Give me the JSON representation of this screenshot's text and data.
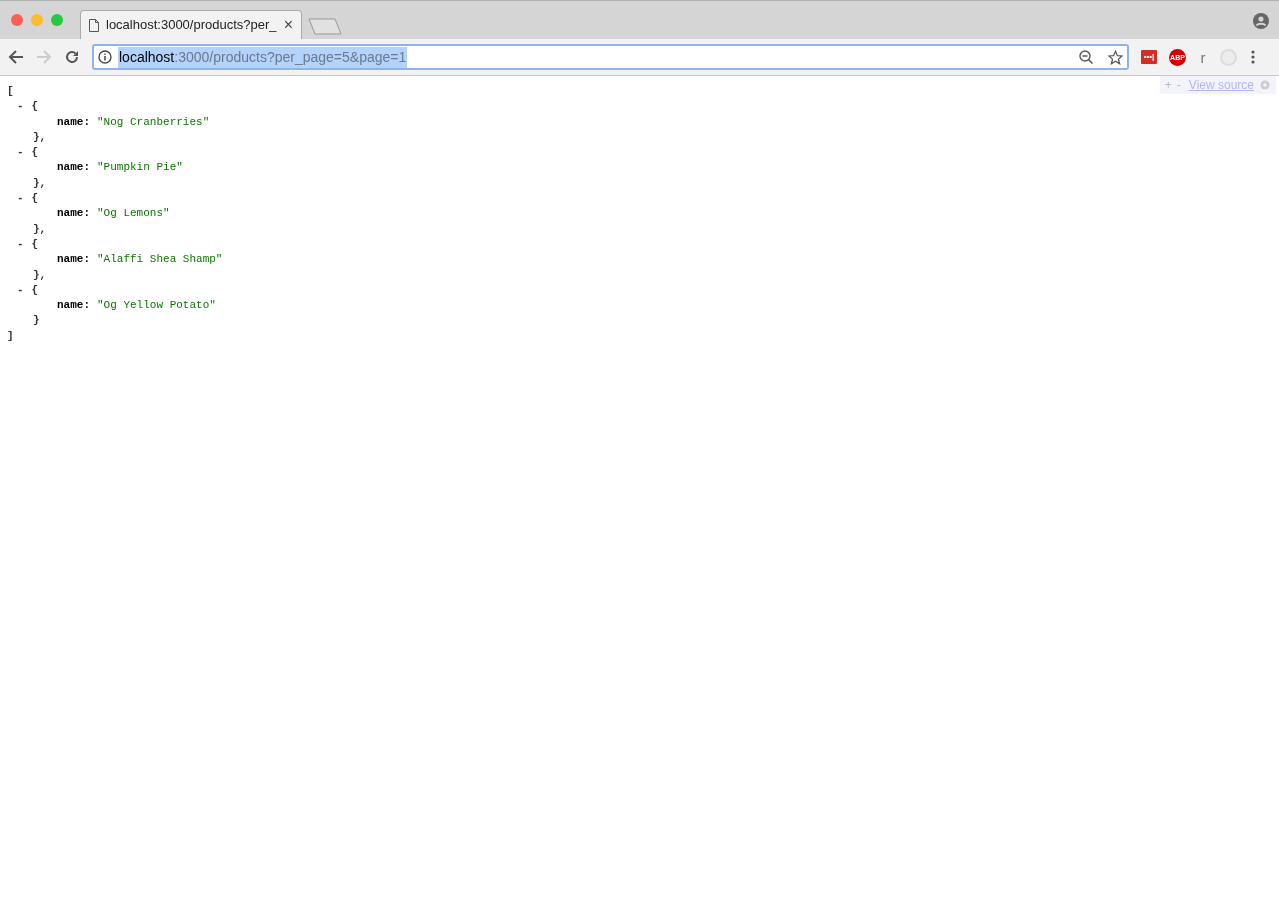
{
  "tab": {
    "title": "localhost:3000/products?per_",
    "close": "×"
  },
  "address_bar": {
    "host": "localhost",
    "rest": ":3000/products?per_page=5&page=1",
    "selected": true
  },
  "extensions": [
    {
      "kind": "lastpass",
      "label": "•••|"
    },
    {
      "kind": "abp",
      "label": "ABP"
    },
    {
      "kind": "letter",
      "label": "r"
    },
    {
      "kind": "ghost"
    }
  ],
  "viewer": {
    "toolbar": {
      "expand": "+",
      "collapse": "-",
      "link": "View source"
    },
    "open_bracket": "[",
    "close_bracket": "]",
    "items": [
      {
        "toggle": "-",
        "open_brace": "{",
        "key": "name:",
        "value": "\"Nog Cranberries\"",
        "close_brace": "},"
      },
      {
        "toggle": "-",
        "open_brace": "{",
        "key": "name:",
        "value": "\"Pumpkin Pie\"",
        "close_brace": "},"
      },
      {
        "toggle": "-",
        "open_brace": "{",
        "key": "name:",
        "value": "\"Og Lemons\"",
        "close_brace": "},"
      },
      {
        "toggle": "-",
        "open_brace": "{",
        "key": "name:",
        "value": "\"Alaffi Shea Shamp\"",
        "close_brace": "},"
      },
      {
        "toggle": "-",
        "open_brace": "{",
        "key": "name:",
        "value": "\"Og Yellow Potato\"",
        "close_brace": "}"
      }
    ]
  }
}
